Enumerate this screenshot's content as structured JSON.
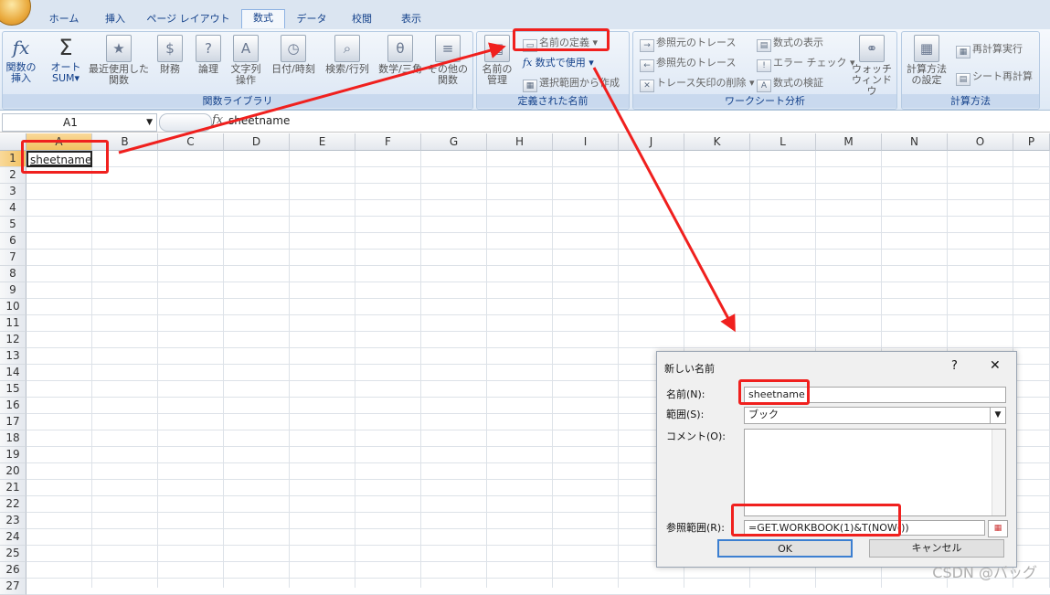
{
  "tabs": [
    "ホーム",
    "挿入",
    "ページ レイアウト",
    "数式",
    "データ",
    "校閲",
    "表示"
  ],
  "active_tab": "数式",
  "ribbon": {
    "library": {
      "label": "関数ライブラリ",
      "insert_function": [
        "関数の",
        "挿入"
      ],
      "autosum": [
        "オート",
        "SUM"
      ],
      "recent": [
        "最近使用した",
        "関数"
      ],
      "financial": "財務",
      "logical": "論理",
      "text": [
        "文字列",
        "操作"
      ],
      "datetime": "日付/時刻",
      "lookup": "検索/行列",
      "math": "数学/三角",
      "more": [
        "その他の",
        "関数"
      ]
    },
    "names": {
      "label": "定義された名前",
      "manager": [
        "名前の",
        "管理"
      ],
      "define_name": "名前の定義",
      "use_in_formula": "数式で使用",
      "create_from_selection": "選択範囲から作成"
    },
    "auditing": {
      "label": "ワークシート分析",
      "trace_precedents": "参照元のトレース",
      "trace_dependents": "参照先のトレース",
      "remove_arrows": "トレース矢印の削除",
      "show_formulas": "数式の表示",
      "error_checking": "エラー チェック",
      "evaluate_formula": "数式の検証",
      "watch_window": [
        "ウォッチ",
        "ウィンドウ"
      ]
    },
    "calculation": {
      "label": "計算方法",
      "options": [
        "計算方法",
        "の設定"
      ],
      "calc_now": "再計算実行",
      "calc_sheet": "シート再計算"
    }
  },
  "formula_bar": {
    "name_box": "A1",
    "fx": "fx",
    "formula": "sheetname"
  },
  "columns": [
    "A",
    "B",
    "C",
    "D",
    "E",
    "F",
    "G",
    "H",
    "I",
    "J",
    "K",
    "L",
    "M",
    "N",
    "O",
    "P"
  ],
  "rows": [
    "1",
    "2",
    "3",
    "4",
    "5",
    "6",
    "7",
    "8",
    "9",
    "10",
    "11",
    "12",
    "13",
    "14",
    "15",
    "16",
    "17",
    "18",
    "19",
    "20",
    "21",
    "22",
    "23",
    "24",
    "25",
    "26",
    "27"
  ],
  "cell_a1": "sheetname",
  "dialog": {
    "title": "新しい名前",
    "help": "?",
    "close": "✕",
    "name_label": "名前(N):",
    "name_value": "sheetname",
    "scope_label": "範囲(S):",
    "scope_value": "ブック",
    "comment_label": "コメント(O):",
    "refers_label": "参照範囲(R):",
    "refers_value": "=GET.WORKBOOK(1)&T(NOW())",
    "ok": "OK",
    "cancel": "キャンセル"
  },
  "watermark": "CSDN @バッグ",
  "colors": {
    "annotation_red": "#f0201e",
    "ribbon_text": "#15428b"
  }
}
